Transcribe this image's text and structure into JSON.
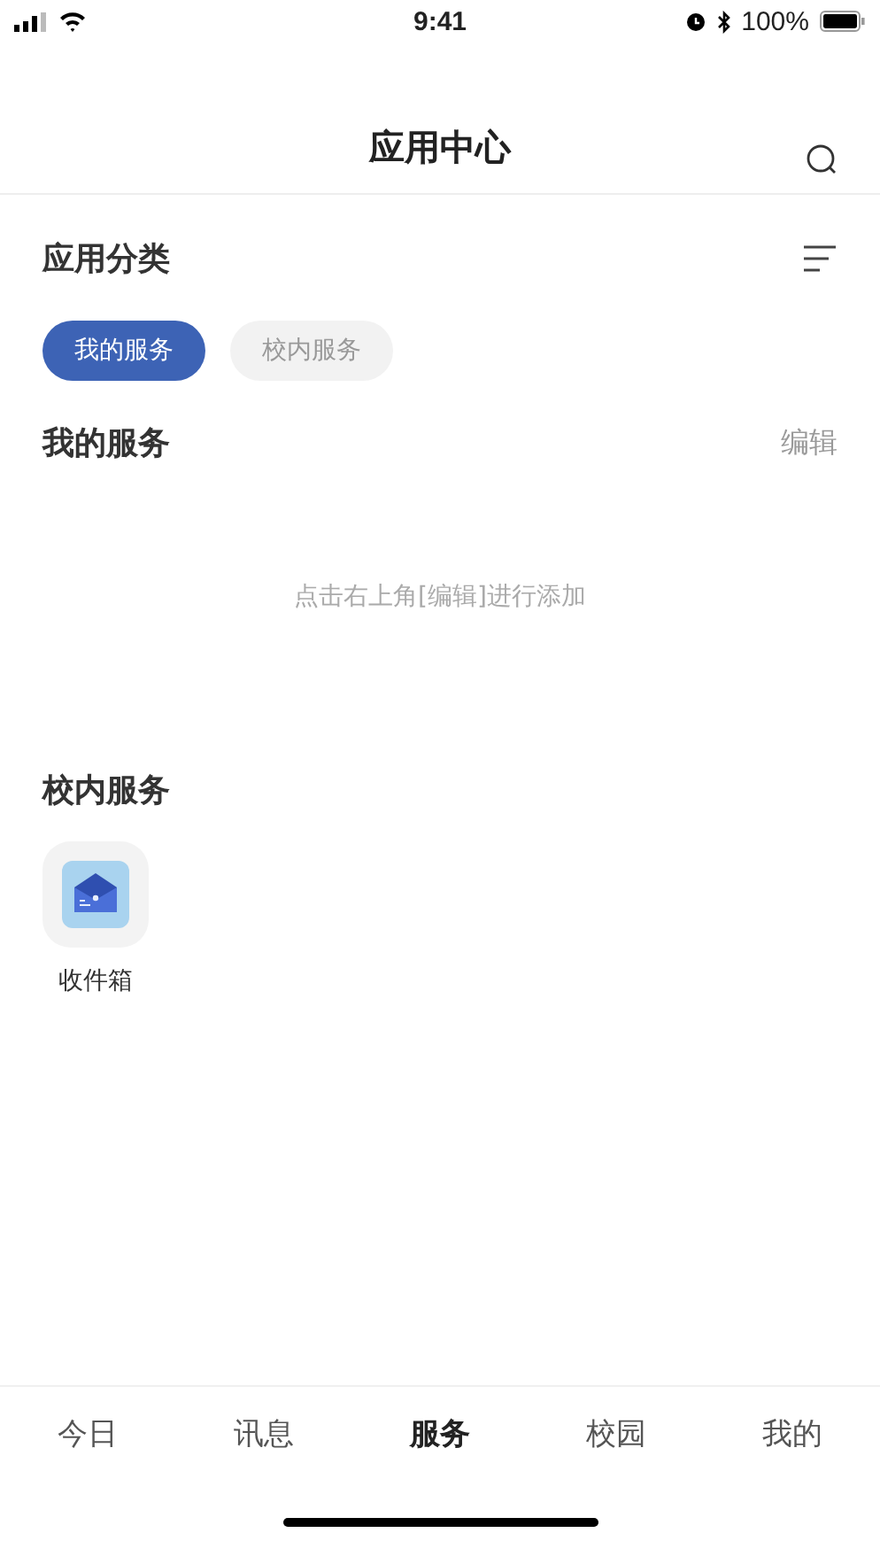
{
  "status_bar": {
    "time": "9:41",
    "battery": "100%"
  },
  "header": {
    "title": "应用中心"
  },
  "category": {
    "title": "应用分类",
    "chips": [
      {
        "label": "我的服务",
        "selected": true
      },
      {
        "label": "校内服务",
        "selected": false
      }
    ]
  },
  "my_services": {
    "title": "我的服务",
    "action": "编辑",
    "empty_text": "点击右上角[编辑]进行添加"
  },
  "campus_services": {
    "title": "校内服务",
    "apps": [
      {
        "label": "收件箱"
      }
    ]
  },
  "tab_bar": [
    {
      "label": "今日",
      "selected": false
    },
    {
      "label": "讯息",
      "selected": false
    },
    {
      "label": "服务",
      "selected": true
    },
    {
      "label": "校园",
      "selected": false
    },
    {
      "label": "我的",
      "selected": false
    }
  ]
}
